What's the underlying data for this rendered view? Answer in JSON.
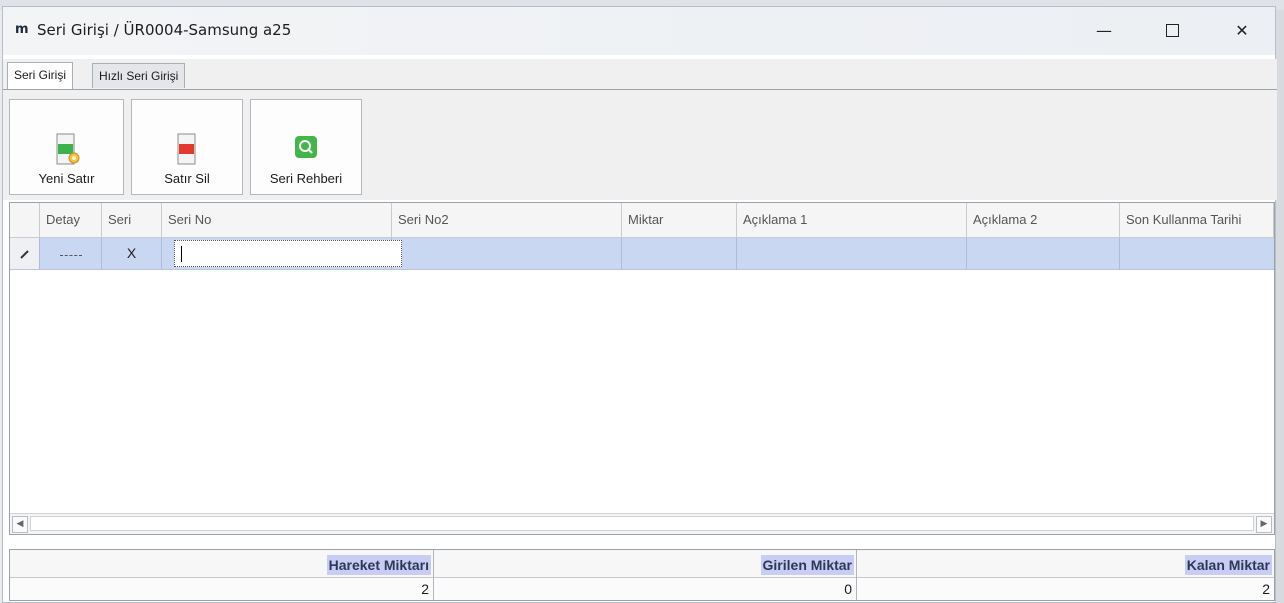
{
  "window": {
    "title": "Seri Girişi / ÜR0004-Samsung a25",
    "logo_text": "m",
    "minimize_symbol": "—",
    "close_symbol": "✕"
  },
  "tabs": [
    {
      "label": "Seri Girişi",
      "active": true
    },
    {
      "label": "Hızlı Seri Girişi",
      "active": false
    }
  ],
  "toolbar": {
    "new_row_label": "Yeni Satır",
    "delete_row_label": "Satır Sil",
    "serial_lookup_label": "Seri Rehberi"
  },
  "grid": {
    "columns": [
      "Detay",
      "Seri",
      "Seri No",
      "Seri No2",
      "Miktar",
      "Açıklama 1",
      "Açıklama 2",
      "Son Kullanma Tarihi"
    ],
    "rows": [
      {
        "seri": "X",
        "seri_no": "",
        "seri_no2": "",
        "miktar": "",
        "aciklama1": "",
        "aciklama2": "",
        "son_kullanma": ""
      }
    ],
    "scroll_left": "◀",
    "scroll_right": "▶"
  },
  "summary": {
    "hareket_label": "Hareket Miktarı",
    "hareket_value": "2",
    "girilen_label": "Girilen Miktar",
    "girilen_value": "0",
    "kalan_label": "Kalan Miktar",
    "kalan_value": "2"
  },
  "colors": {
    "selected_row": "#c9d7f2",
    "summary_label_bg": "#c9cdf5",
    "icon_green": "#3bb34a",
    "icon_red": "#e23b2e"
  }
}
